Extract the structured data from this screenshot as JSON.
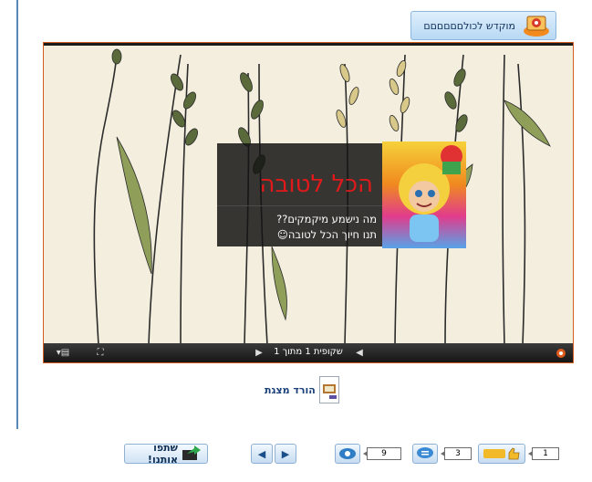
{
  "dedication": {
    "label": "מוקדש לכולםםםםםם",
    "icon": "envelope-mascot-icon"
  },
  "viewer": {
    "caption_title": "הכל לטובה",
    "caption_line1": "מה נישמע מיקמקים??",
    "caption_line2": "תנו חיוך הכל לטובה☺",
    "slide_label": "שקופית 1 מתוך 1",
    "accent_color": "#d35d1e",
    "title_color": "#e01a1a"
  },
  "download": {
    "label": "הורד מצגת",
    "icon": "presentation-file-icon"
  },
  "toolbar": {
    "share_label": "שתפו אותנו!",
    "views_count": "9",
    "comments_count": "3",
    "likes_count": "1"
  }
}
